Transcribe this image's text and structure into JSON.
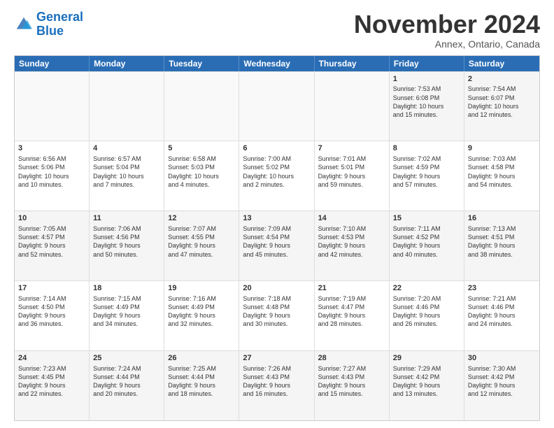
{
  "logo": {
    "line1": "General",
    "line2": "Blue"
  },
  "title": "November 2024",
  "location": "Annex, Ontario, Canada",
  "days": [
    "Sunday",
    "Monday",
    "Tuesday",
    "Wednesday",
    "Thursday",
    "Friday",
    "Saturday"
  ],
  "weeks": [
    [
      {
        "day": "",
        "info": ""
      },
      {
        "day": "",
        "info": ""
      },
      {
        "day": "",
        "info": ""
      },
      {
        "day": "",
        "info": ""
      },
      {
        "day": "",
        "info": ""
      },
      {
        "day": "1",
        "info": "Sunrise: 7:53 AM\nSunset: 6:08 PM\nDaylight: 10 hours\nand 15 minutes."
      },
      {
        "day": "2",
        "info": "Sunrise: 7:54 AM\nSunset: 6:07 PM\nDaylight: 10 hours\nand 12 minutes."
      }
    ],
    [
      {
        "day": "3",
        "info": "Sunrise: 6:56 AM\nSunset: 5:06 PM\nDaylight: 10 hours\nand 10 minutes."
      },
      {
        "day": "4",
        "info": "Sunrise: 6:57 AM\nSunset: 5:04 PM\nDaylight: 10 hours\nand 7 minutes."
      },
      {
        "day": "5",
        "info": "Sunrise: 6:58 AM\nSunset: 5:03 PM\nDaylight: 10 hours\nand 4 minutes."
      },
      {
        "day": "6",
        "info": "Sunrise: 7:00 AM\nSunset: 5:02 PM\nDaylight: 10 hours\nand 2 minutes."
      },
      {
        "day": "7",
        "info": "Sunrise: 7:01 AM\nSunset: 5:01 PM\nDaylight: 9 hours\nand 59 minutes."
      },
      {
        "day": "8",
        "info": "Sunrise: 7:02 AM\nSunset: 4:59 PM\nDaylight: 9 hours\nand 57 minutes."
      },
      {
        "day": "9",
        "info": "Sunrise: 7:03 AM\nSunset: 4:58 PM\nDaylight: 9 hours\nand 54 minutes."
      }
    ],
    [
      {
        "day": "10",
        "info": "Sunrise: 7:05 AM\nSunset: 4:57 PM\nDaylight: 9 hours\nand 52 minutes."
      },
      {
        "day": "11",
        "info": "Sunrise: 7:06 AM\nSunset: 4:56 PM\nDaylight: 9 hours\nand 50 minutes."
      },
      {
        "day": "12",
        "info": "Sunrise: 7:07 AM\nSunset: 4:55 PM\nDaylight: 9 hours\nand 47 minutes."
      },
      {
        "day": "13",
        "info": "Sunrise: 7:09 AM\nSunset: 4:54 PM\nDaylight: 9 hours\nand 45 minutes."
      },
      {
        "day": "14",
        "info": "Sunrise: 7:10 AM\nSunset: 4:53 PM\nDaylight: 9 hours\nand 42 minutes."
      },
      {
        "day": "15",
        "info": "Sunrise: 7:11 AM\nSunset: 4:52 PM\nDaylight: 9 hours\nand 40 minutes."
      },
      {
        "day": "16",
        "info": "Sunrise: 7:13 AM\nSunset: 4:51 PM\nDaylight: 9 hours\nand 38 minutes."
      }
    ],
    [
      {
        "day": "17",
        "info": "Sunrise: 7:14 AM\nSunset: 4:50 PM\nDaylight: 9 hours\nand 36 minutes."
      },
      {
        "day": "18",
        "info": "Sunrise: 7:15 AM\nSunset: 4:49 PM\nDaylight: 9 hours\nand 34 minutes."
      },
      {
        "day": "19",
        "info": "Sunrise: 7:16 AM\nSunset: 4:49 PM\nDaylight: 9 hours\nand 32 minutes."
      },
      {
        "day": "20",
        "info": "Sunrise: 7:18 AM\nSunset: 4:48 PM\nDaylight: 9 hours\nand 30 minutes."
      },
      {
        "day": "21",
        "info": "Sunrise: 7:19 AM\nSunset: 4:47 PM\nDaylight: 9 hours\nand 28 minutes."
      },
      {
        "day": "22",
        "info": "Sunrise: 7:20 AM\nSunset: 4:46 PM\nDaylight: 9 hours\nand 26 minutes."
      },
      {
        "day": "23",
        "info": "Sunrise: 7:21 AM\nSunset: 4:46 PM\nDaylight: 9 hours\nand 24 minutes."
      }
    ],
    [
      {
        "day": "24",
        "info": "Sunrise: 7:23 AM\nSunset: 4:45 PM\nDaylight: 9 hours\nand 22 minutes."
      },
      {
        "day": "25",
        "info": "Sunrise: 7:24 AM\nSunset: 4:44 PM\nDaylight: 9 hours\nand 20 minutes."
      },
      {
        "day": "26",
        "info": "Sunrise: 7:25 AM\nSunset: 4:44 PM\nDaylight: 9 hours\nand 18 minutes."
      },
      {
        "day": "27",
        "info": "Sunrise: 7:26 AM\nSunset: 4:43 PM\nDaylight: 9 hours\nand 16 minutes."
      },
      {
        "day": "28",
        "info": "Sunrise: 7:27 AM\nSunset: 4:43 PM\nDaylight: 9 hours\nand 15 minutes."
      },
      {
        "day": "29",
        "info": "Sunrise: 7:29 AM\nSunset: 4:42 PM\nDaylight: 9 hours\nand 13 minutes."
      },
      {
        "day": "30",
        "info": "Sunrise: 7:30 AM\nSunset: 4:42 PM\nDaylight: 9 hours\nand 12 minutes."
      }
    ]
  ]
}
